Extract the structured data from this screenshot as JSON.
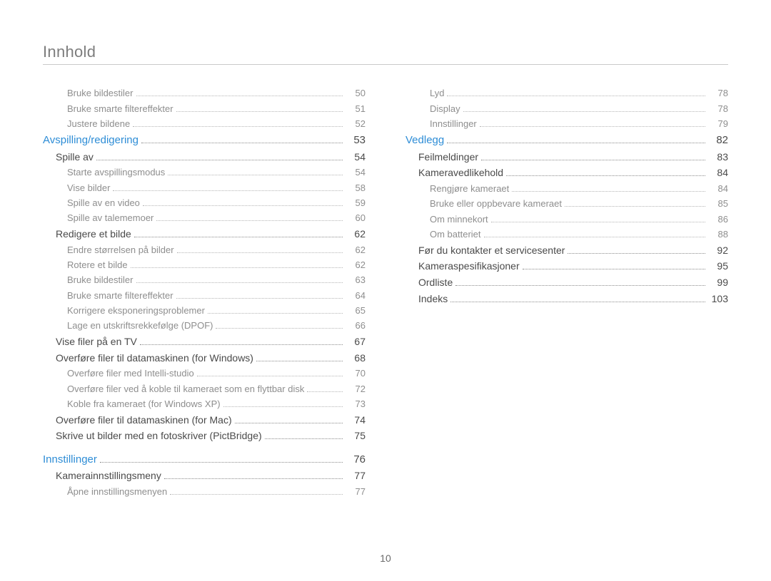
{
  "header": {
    "title": "Innhold"
  },
  "page_number": "10",
  "columns": [
    {
      "entries": [
        {
          "label": "Bruke bildestiler",
          "page": "50",
          "level": 2
        },
        {
          "label": "Bruke smarte filtereffekter",
          "page": "51",
          "level": 2
        },
        {
          "label": "Justere bildene",
          "page": "52",
          "level": 2
        },
        {
          "label": "Avspilling/redigering",
          "page": "53",
          "level": 0,
          "first": true
        },
        {
          "label": "Spille av",
          "page": "54",
          "level": 1
        },
        {
          "label": "Starte avspillingsmodus",
          "page": "54",
          "level": 2
        },
        {
          "label": "Vise bilder",
          "page": "58",
          "level": 2
        },
        {
          "label": "Spille av en video",
          "page": "59",
          "level": 2
        },
        {
          "label": "Spille av talememoer",
          "page": "60",
          "level": 2
        },
        {
          "label": "Redigere et bilde",
          "page": "62",
          "level": 1
        },
        {
          "label": "Endre størrelsen på bilder",
          "page": "62",
          "level": 2
        },
        {
          "label": "Rotere et bilde",
          "page": "62",
          "level": 2
        },
        {
          "label": "Bruke bildestiler",
          "page": "63",
          "level": 2
        },
        {
          "label": "Bruke smarte filtereffekter",
          "page": "64",
          "level": 2
        },
        {
          "label": "Korrigere eksponeringsproblemer",
          "page": "65",
          "level": 2
        },
        {
          "label": "Lage en utskriftsrekkefølge (DPOF)",
          "page": "66",
          "level": 2
        },
        {
          "label": "Vise filer på en TV",
          "page": "67",
          "level": 1
        },
        {
          "label": "Overføre filer til datamaskinen (for Windows)",
          "page": "68",
          "level": 1
        },
        {
          "label": "Overføre filer med Intelli-studio",
          "page": "70",
          "level": 2
        },
        {
          "label": "Overføre filer ved å koble til kameraet som en flyttbar disk",
          "page": "72",
          "level": 2
        },
        {
          "label": "Koble fra kameraet (for Windows XP)",
          "page": "73",
          "level": 2
        },
        {
          "label": "Overføre filer til datamaskinen (for Mac)",
          "page": "74",
          "level": 1
        },
        {
          "label": "Skrive ut bilder med en fotoskriver (PictBridge)",
          "page": "75",
          "level": 1
        },
        {
          "label": "Innstillinger",
          "page": "76",
          "level": 0
        },
        {
          "label": "Kamerainnstillingsmeny",
          "page": "77",
          "level": 1
        },
        {
          "label": "Åpne innstillingsmenyen",
          "page": "77",
          "level": 2
        }
      ]
    },
    {
      "entries": [
        {
          "label": "Lyd",
          "page": "78",
          "level": 2
        },
        {
          "label": "Display",
          "page": "78",
          "level": 2
        },
        {
          "label": "Innstillinger",
          "page": "79",
          "level": 2
        },
        {
          "label": "Vedlegg",
          "page": "82",
          "level": 0,
          "first": true
        },
        {
          "label": "Feilmeldinger",
          "page": "83",
          "level": 1
        },
        {
          "label": "Kameravedlikehold",
          "page": "84",
          "level": 1
        },
        {
          "label": "Rengjøre kameraet",
          "page": "84",
          "level": 2
        },
        {
          "label": "Bruke eller oppbevare kameraet",
          "page": "85",
          "level": 2
        },
        {
          "label": "Om minnekort",
          "page": "86",
          "level": 2
        },
        {
          "label": "Om batteriet",
          "page": "88",
          "level": 2
        },
        {
          "label": "Før du kontakter et servicesenter",
          "page": "92",
          "level": 1
        },
        {
          "label": "Kameraspesifikasjoner",
          "page": "95",
          "level": 1
        },
        {
          "label": "Ordliste",
          "page": "99",
          "level": 1
        },
        {
          "label": "Indeks",
          "page": "103",
          "level": 1
        }
      ]
    }
  ]
}
